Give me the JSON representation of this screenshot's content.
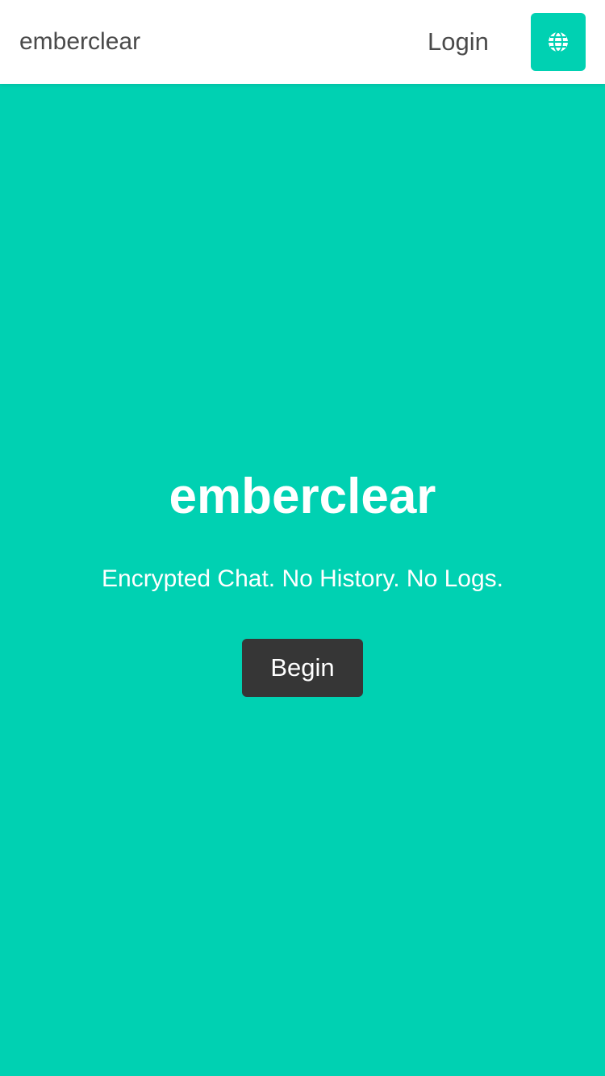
{
  "navbar": {
    "brand": "emberclear",
    "login_label": "Login",
    "language_icon": "globe-icon"
  },
  "hero": {
    "title": "emberclear",
    "subtitle": "Encrypted Chat. No History. No Logs.",
    "begin_label": "Begin"
  },
  "colors": {
    "primary": "#00d1b2",
    "navbar_background": "#ffffff",
    "navbar_text": "#4a4a4a",
    "button_dark": "#363636",
    "hero_text": "#ffffff"
  }
}
